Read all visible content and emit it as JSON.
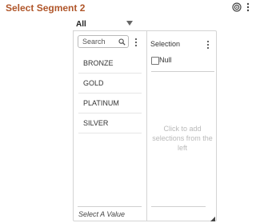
{
  "header": {
    "title": "Select Segment 2",
    "icons": [
      "target-icon",
      "kebab-menu-icon"
    ]
  },
  "dropdown": {
    "value": "All"
  },
  "left_panel": {
    "search_placeholder": "Search",
    "items": [
      {
        "label": "BRONZE"
      },
      {
        "label": "GOLD"
      },
      {
        "label": "PLATINUM"
      },
      {
        "label": "SILVER"
      }
    ],
    "footer_placeholder": "Select A Value"
  },
  "right_panel": {
    "header": "Selection",
    "null_label": "Null",
    "null_checked": false,
    "empty_message": "Click to add selections from the left"
  },
  "colors": {
    "title": "#b0562a",
    "muted_text": "#b9b9b9",
    "border": "#d4d4d4"
  }
}
